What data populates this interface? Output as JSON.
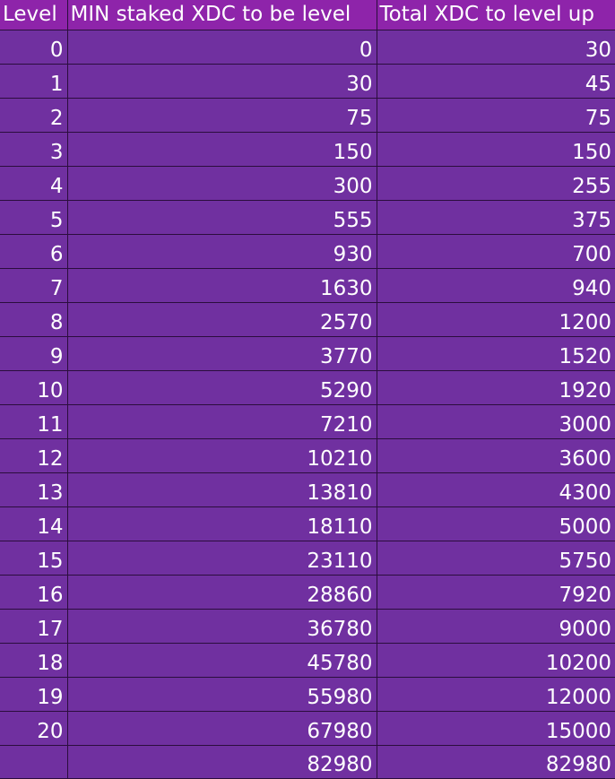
{
  "table": {
    "headers": [
      "Level",
      "MIN staked XDC to be level",
      "Total XDC to level up"
    ],
    "rows": [
      [
        "0",
        "0",
        "30"
      ],
      [
        "1",
        "30",
        "45"
      ],
      [
        "2",
        "75",
        "75"
      ],
      [
        "3",
        "150",
        "150"
      ],
      [
        "4",
        "300",
        "255"
      ],
      [
        "5",
        "555",
        "375"
      ],
      [
        "6",
        "930",
        "700"
      ],
      [
        "7",
        "1630",
        "940"
      ],
      [
        "8",
        "2570",
        "1200"
      ],
      [
        "9",
        "3770",
        "1520"
      ],
      [
        "10",
        "5290",
        "1920"
      ],
      [
        "11",
        "7210",
        "3000"
      ],
      [
        "12",
        "10210",
        "3600"
      ],
      [
        "13",
        "13810",
        "4300"
      ],
      [
        "14",
        "18110",
        "5000"
      ],
      [
        "15",
        "23110",
        "5750"
      ],
      [
        "16",
        "28860",
        "7920"
      ],
      [
        "17",
        "36780",
        "9000"
      ],
      [
        "18",
        "45780",
        "10200"
      ],
      [
        "19",
        "55980",
        "12000"
      ],
      [
        "20",
        "67980",
        "15000"
      ],
      [
        "",
        "82980",
        "82980"
      ]
    ]
  },
  "colors": {
    "header_bg": "#8e24aa",
    "cell_bg": "#7030a0",
    "grid": "#2b0d3d",
    "text": "#ffffff"
  }
}
